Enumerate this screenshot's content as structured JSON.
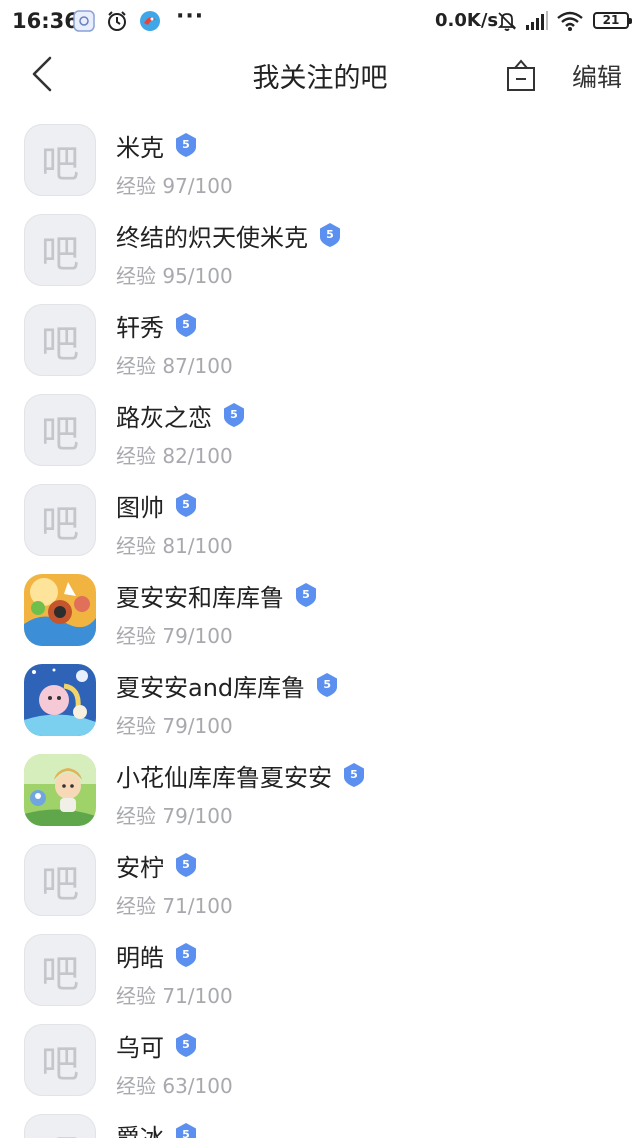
{
  "status_bar": {
    "time": "16:36",
    "network_speed": "0.0K/s",
    "battery": "21",
    "icons": [
      "notification-app-icon",
      "alarm-icon",
      "app-bird-icon",
      "more-dots-icon",
      "mute-icon",
      "signal-icon",
      "wifi-icon",
      "battery-icon"
    ]
  },
  "header": {
    "title": "我关注的吧",
    "back_icon": "chevron-left-icon",
    "sort_icon": "sort-box-icon",
    "edit_label": "编辑"
  },
  "colors": {
    "badge_blue": "#5b8ff0",
    "exp_gray": "#a7a9ae",
    "avatar_bg": "#eeeff2"
  },
  "forums": [
    {
      "name": "米克",
      "level": "5",
      "exp": "经验 97/100",
      "avatar": "default",
      "avatar_glyph": "吧"
    },
    {
      "name": "终结的炽天使米克",
      "level": "5",
      "exp": "经验 95/100",
      "avatar": "default",
      "avatar_glyph": "吧"
    },
    {
      "name": "轩秀",
      "level": "5",
      "exp": "经验 87/100",
      "avatar": "default",
      "avatar_glyph": "吧"
    },
    {
      "name": "路灰之恋",
      "level": "5",
      "exp": "经验 82/100",
      "avatar": "default",
      "avatar_glyph": "吧"
    },
    {
      "name": "图帅",
      "level": "5",
      "exp": "经验 81/100",
      "avatar": "default",
      "avatar_glyph": "吧"
    },
    {
      "name": "夏安安和库库鲁",
      "level": "5",
      "exp": "经验 79/100",
      "avatar": "image-cartoon-battle",
      "avatar_glyph": ""
    },
    {
      "name": "夏安安and库库鲁",
      "level": "5",
      "exp": "经验 79/100",
      "avatar": "image-cartoon-night",
      "avatar_glyph": ""
    },
    {
      "name": "小花仙库库鲁夏安安",
      "level": "5",
      "exp": "经验 79/100",
      "avatar": "image-cartoon-garden",
      "avatar_glyph": ""
    },
    {
      "name": "安柠",
      "level": "5",
      "exp": "经验 71/100",
      "avatar": "default",
      "avatar_glyph": "吧"
    },
    {
      "name": "明皓",
      "level": "5",
      "exp": "经验 71/100",
      "avatar": "default",
      "avatar_glyph": "吧"
    },
    {
      "name": "乌可",
      "level": "5",
      "exp": "经验 63/100",
      "avatar": "default",
      "avatar_glyph": "吧"
    },
    {
      "name": "爵冰",
      "level": "5",
      "exp": "",
      "avatar": "default",
      "avatar_glyph": "吧"
    }
  ]
}
